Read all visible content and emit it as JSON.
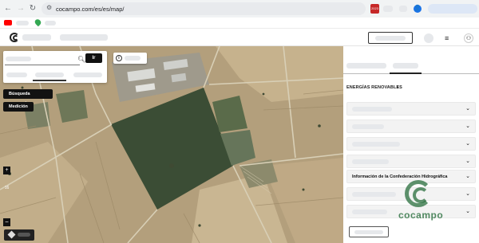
{
  "browser": {
    "url": "cocampo.com/es/es/map/",
    "extension_badge": "2023",
    "profile_initial": "👤"
  },
  "header": {
    "logo": "cocampo"
  },
  "map": {
    "search": {
      "go_label": "Ir",
      "search_icon": "search-icon"
    },
    "info_icon": "info-icon",
    "progressive_search_label": "Búsqueda progresiva",
    "measure_label": "Medición",
    "zoom": {
      "plus": "+",
      "level": "16",
      "minus": "−"
    },
    "layers_icon": "layers-icon"
  },
  "side_panel": {
    "section_title": "ENERGÍAS RENOVABLES",
    "section_arrow": "›",
    "accordion_items": [
      {
        "label": ""
      },
      {
        "label": ""
      },
      {
        "label": ""
      },
      {
        "label": ""
      },
      {
        "label": ""
      },
      {
        "label": "Información de la Confederación Hidrográfica"
      },
      {
        "label": ""
      },
      {
        "label": ""
      }
    ],
    "chevron": "⌄"
  },
  "watermark": {
    "text": "cocampo"
  },
  "colors": {
    "field_dark_green": "#3b4d35",
    "soil": "#b4a07e",
    "button_dark": "#121212",
    "brand_green": "#286e3c"
  }
}
